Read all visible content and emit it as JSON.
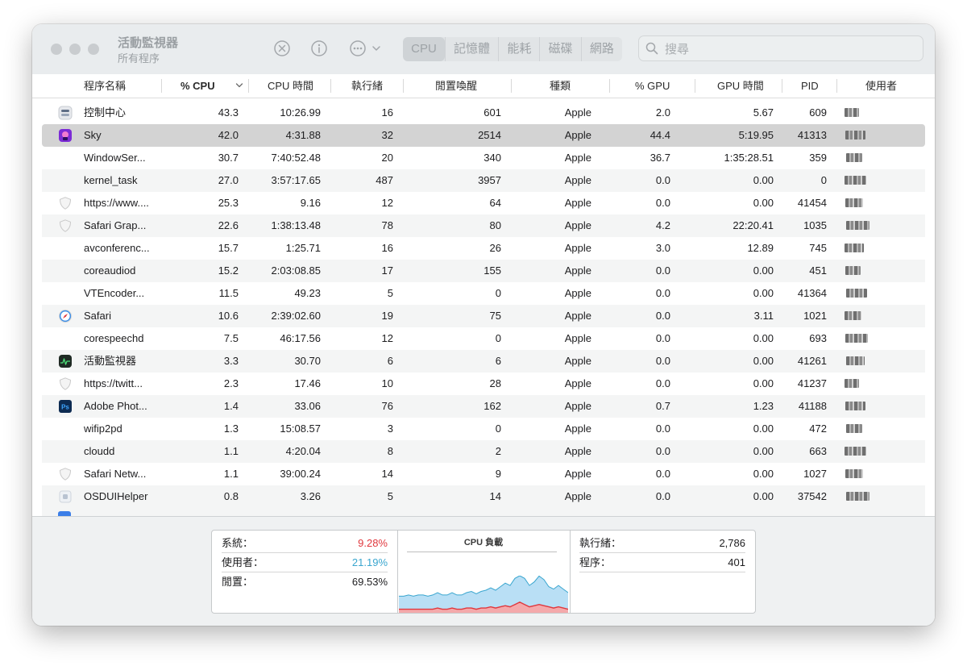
{
  "window": {
    "title": "活動監視器",
    "subtitle": "所有程序",
    "tabs": [
      {
        "label": "CPU",
        "active": true
      },
      {
        "label": "記憶體",
        "active": false
      },
      {
        "label": "能耗",
        "active": false
      },
      {
        "label": "磁碟",
        "active": false
      },
      {
        "label": "網路",
        "active": false
      }
    ],
    "search": {
      "placeholder": "搜尋",
      "value": ""
    }
  },
  "columns": {
    "name": "程序名稱",
    "cpu": "% CPU",
    "cpu_time": "CPU 時間",
    "threads": "執行緒",
    "idle_wake": "閒置喚醒",
    "kind": "種類",
    "gpu": "% GPU",
    "gpu_time": "GPU 時間",
    "pid": "PID",
    "user": "使用者"
  },
  "sort": {
    "column": "cpu",
    "direction": "descending"
  },
  "rows": [
    {
      "icon": "control-center-icon",
      "name": "控制中心",
      "cpu": "43.3",
      "cpu_time": "10:26.99",
      "threads": "16",
      "idle_wake": "601",
      "kind": "Apple",
      "gpu": "2.0",
      "gpu_time": "5.67",
      "pid": "609"
    },
    {
      "icon": "sky-app-icon",
      "name": "Sky",
      "cpu": "42.0",
      "cpu_time": "4:31.88",
      "threads": "32",
      "idle_wake": "2514",
      "kind": "Apple",
      "gpu": "44.4",
      "gpu_time": "5:19.95",
      "pid": "41313",
      "selected": true
    },
    {
      "icon": "",
      "name": "WindowSer...",
      "cpu": "30.7",
      "cpu_time": "7:40:52.48",
      "threads": "20",
      "idle_wake": "340",
      "kind": "Apple",
      "gpu": "36.7",
      "gpu_time": "1:35:28.51",
      "pid": "359"
    },
    {
      "icon": "",
      "name": "kernel_task",
      "cpu": "27.0",
      "cpu_time": "3:57:17.65",
      "threads": "487",
      "idle_wake": "3957",
      "kind": "Apple",
      "gpu": "0.0",
      "gpu_time": "0.00",
      "pid": "0"
    },
    {
      "icon": "shield-icon",
      "name": "https://www....",
      "cpu": "25.3",
      "cpu_time": "9.16",
      "threads": "12",
      "idle_wake": "64",
      "kind": "Apple",
      "gpu": "0.0",
      "gpu_time": "0.00",
      "pid": "41454"
    },
    {
      "icon": "shield-icon",
      "name": "Safari Grap...",
      "cpu": "22.6",
      "cpu_time": "1:38:13.48",
      "threads": "78",
      "idle_wake": "80",
      "kind": "Apple",
      "gpu": "4.2",
      "gpu_time": "22:20.41",
      "pid": "1035"
    },
    {
      "icon": "",
      "name": "avconferenc...",
      "cpu": "15.7",
      "cpu_time": "1:25.71",
      "threads": "16",
      "idle_wake": "26",
      "kind": "Apple",
      "gpu": "3.0",
      "gpu_time": "12.89",
      "pid": "745"
    },
    {
      "icon": "",
      "name": "coreaudiod",
      "cpu": "15.2",
      "cpu_time": "2:03:08.85",
      "threads": "17",
      "idle_wake": "155",
      "kind": "Apple",
      "gpu": "0.0",
      "gpu_time": "0.00",
      "pid": "451"
    },
    {
      "icon": "",
      "name": "VTEncoder...",
      "cpu": "11.5",
      "cpu_time": "49.23",
      "threads": "5",
      "idle_wake": "0",
      "kind": "Apple",
      "gpu": "0.0",
      "gpu_time": "0.00",
      "pid": "41364"
    },
    {
      "icon": "safari-icon",
      "name": "Safari",
      "cpu": "10.6",
      "cpu_time": "2:39:02.60",
      "threads": "19",
      "idle_wake": "75",
      "kind": "Apple",
      "gpu": "0.0",
      "gpu_time": "3.11",
      "pid": "1021"
    },
    {
      "icon": "",
      "name": "corespeechd",
      "cpu": "7.5",
      "cpu_time": "46:17.56",
      "threads": "12",
      "idle_wake": "0",
      "kind": "Apple",
      "gpu": "0.0",
      "gpu_time": "0.00",
      "pid": "693"
    },
    {
      "icon": "activity-monitor-icon",
      "name": "活動監視器",
      "cpu": "3.3",
      "cpu_time": "30.70",
      "threads": "6",
      "idle_wake": "6",
      "kind": "Apple",
      "gpu": "0.0",
      "gpu_time": "0.00",
      "pid": "41261"
    },
    {
      "icon": "shield-icon",
      "name": "https://twitt...",
      "cpu": "2.3",
      "cpu_time": "17.46",
      "threads": "10",
      "idle_wake": "28",
      "kind": "Apple",
      "gpu": "0.0",
      "gpu_time": "0.00",
      "pid": "41237"
    },
    {
      "icon": "photoshop-icon",
      "name": "Adobe Phot...",
      "cpu": "1.4",
      "cpu_time": "33.06",
      "threads": "76",
      "idle_wake": "162",
      "kind": "Apple",
      "gpu": "0.7",
      "gpu_time": "1.23",
      "pid": "41188"
    },
    {
      "icon": "",
      "name": "wifip2pd",
      "cpu": "1.3",
      "cpu_time": "15:08.57",
      "threads": "3",
      "idle_wake": "0",
      "kind": "Apple",
      "gpu": "0.0",
      "gpu_time": "0.00",
      "pid": "472"
    },
    {
      "icon": "",
      "name": "cloudd",
      "cpu": "1.1",
      "cpu_time": "4:20.04",
      "threads": "8",
      "idle_wake": "2",
      "kind": "Apple",
      "gpu": "0.0",
      "gpu_time": "0.00",
      "pid": "663"
    },
    {
      "icon": "shield-icon",
      "name": "Safari Netw...",
      "cpu": "1.1",
      "cpu_time": "39:00.24",
      "threads": "14",
      "idle_wake": "9",
      "kind": "Apple",
      "gpu": "0.0",
      "gpu_time": "0.00",
      "pid": "1027"
    },
    {
      "icon": "osdui-icon",
      "name": "OSDUIHelper",
      "cpu": "0.8",
      "cpu_time": "3.26",
      "threads": "5",
      "idle_wake": "14",
      "kind": "Apple",
      "gpu": "0.0",
      "gpu_time": "0.00",
      "pid": "37542"
    }
  ],
  "summary": {
    "system_label": "系統：",
    "system_value": "9.28%",
    "user_label": "使用者：",
    "user_value": "21.19%",
    "idle_label": "閒置：",
    "idle_value": "69.53%",
    "chart_title": "CPU 負載",
    "threads_label": "執行緒：",
    "threads_value": "2,786",
    "processes_label": "程序：",
    "processes_value": "401"
  },
  "colors": {
    "system": "#e0383e",
    "user": "#3aa6cf",
    "user_fill": "#b9dff5",
    "system_fill": "#f4a9ab"
  },
  "cpu_load": {
    "user_percent": [
      11,
      11,
      12,
      11,
      12,
      12,
      11,
      12,
      13,
      12,
      12,
      13,
      12,
      12,
      13,
      14,
      13,
      14,
      15,
      16,
      15,
      17,
      19,
      18,
      22,
      28,
      22,
      18,
      20,
      24,
      22,
      17,
      16,
      18,
      16,
      14
    ],
    "system_percent": [
      3,
      3,
      3,
      3,
      3,
      3,
      3,
      3,
      4,
      3,
      3,
      4,
      3,
      3,
      4,
      4,
      3,
      4,
      4,
      5,
      4,
      5,
      6,
      5,
      7,
      9,
      7,
      5,
      6,
      7,
      6,
      5,
      4,
      5,
      4,
      3
    ]
  }
}
